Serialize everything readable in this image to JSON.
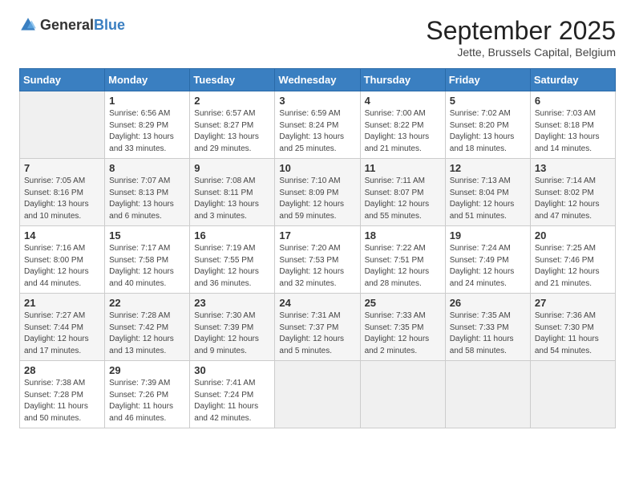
{
  "header": {
    "logo_general": "General",
    "logo_blue": "Blue",
    "month_year": "September 2025",
    "location": "Jette, Brussels Capital, Belgium"
  },
  "days_of_week": [
    "Sunday",
    "Monday",
    "Tuesday",
    "Wednesday",
    "Thursday",
    "Friday",
    "Saturday"
  ],
  "weeks": [
    [
      {
        "day": "",
        "sunrise": "",
        "sunset": "",
        "daylight": ""
      },
      {
        "day": "1",
        "sunrise": "Sunrise: 6:56 AM",
        "sunset": "Sunset: 8:29 PM",
        "daylight": "Daylight: 13 hours and 33 minutes."
      },
      {
        "day": "2",
        "sunrise": "Sunrise: 6:57 AM",
        "sunset": "Sunset: 8:27 PM",
        "daylight": "Daylight: 13 hours and 29 minutes."
      },
      {
        "day": "3",
        "sunrise": "Sunrise: 6:59 AM",
        "sunset": "Sunset: 8:24 PM",
        "daylight": "Daylight: 13 hours and 25 minutes."
      },
      {
        "day": "4",
        "sunrise": "Sunrise: 7:00 AM",
        "sunset": "Sunset: 8:22 PM",
        "daylight": "Daylight: 13 hours and 21 minutes."
      },
      {
        "day": "5",
        "sunrise": "Sunrise: 7:02 AM",
        "sunset": "Sunset: 8:20 PM",
        "daylight": "Daylight: 13 hours and 18 minutes."
      },
      {
        "day": "6",
        "sunrise": "Sunrise: 7:03 AM",
        "sunset": "Sunset: 8:18 PM",
        "daylight": "Daylight: 13 hours and 14 minutes."
      }
    ],
    [
      {
        "day": "7",
        "sunrise": "Sunrise: 7:05 AM",
        "sunset": "Sunset: 8:16 PM",
        "daylight": "Daylight: 13 hours and 10 minutes."
      },
      {
        "day": "8",
        "sunrise": "Sunrise: 7:07 AM",
        "sunset": "Sunset: 8:13 PM",
        "daylight": "Daylight: 13 hours and 6 minutes."
      },
      {
        "day": "9",
        "sunrise": "Sunrise: 7:08 AM",
        "sunset": "Sunset: 8:11 PM",
        "daylight": "Daylight: 13 hours and 3 minutes."
      },
      {
        "day": "10",
        "sunrise": "Sunrise: 7:10 AM",
        "sunset": "Sunset: 8:09 PM",
        "daylight": "Daylight: 12 hours and 59 minutes."
      },
      {
        "day": "11",
        "sunrise": "Sunrise: 7:11 AM",
        "sunset": "Sunset: 8:07 PM",
        "daylight": "Daylight: 12 hours and 55 minutes."
      },
      {
        "day": "12",
        "sunrise": "Sunrise: 7:13 AM",
        "sunset": "Sunset: 8:04 PM",
        "daylight": "Daylight: 12 hours and 51 minutes."
      },
      {
        "day": "13",
        "sunrise": "Sunrise: 7:14 AM",
        "sunset": "Sunset: 8:02 PM",
        "daylight": "Daylight: 12 hours and 47 minutes."
      }
    ],
    [
      {
        "day": "14",
        "sunrise": "Sunrise: 7:16 AM",
        "sunset": "Sunset: 8:00 PM",
        "daylight": "Daylight: 12 hours and 44 minutes."
      },
      {
        "day": "15",
        "sunrise": "Sunrise: 7:17 AM",
        "sunset": "Sunset: 7:58 PM",
        "daylight": "Daylight: 12 hours and 40 minutes."
      },
      {
        "day": "16",
        "sunrise": "Sunrise: 7:19 AM",
        "sunset": "Sunset: 7:55 PM",
        "daylight": "Daylight: 12 hours and 36 minutes."
      },
      {
        "day": "17",
        "sunrise": "Sunrise: 7:20 AM",
        "sunset": "Sunset: 7:53 PM",
        "daylight": "Daylight: 12 hours and 32 minutes."
      },
      {
        "day": "18",
        "sunrise": "Sunrise: 7:22 AM",
        "sunset": "Sunset: 7:51 PM",
        "daylight": "Daylight: 12 hours and 28 minutes."
      },
      {
        "day": "19",
        "sunrise": "Sunrise: 7:24 AM",
        "sunset": "Sunset: 7:49 PM",
        "daylight": "Daylight: 12 hours and 24 minutes."
      },
      {
        "day": "20",
        "sunrise": "Sunrise: 7:25 AM",
        "sunset": "Sunset: 7:46 PM",
        "daylight": "Daylight: 12 hours and 21 minutes."
      }
    ],
    [
      {
        "day": "21",
        "sunrise": "Sunrise: 7:27 AM",
        "sunset": "Sunset: 7:44 PM",
        "daylight": "Daylight: 12 hours and 17 minutes."
      },
      {
        "day": "22",
        "sunrise": "Sunrise: 7:28 AM",
        "sunset": "Sunset: 7:42 PM",
        "daylight": "Daylight: 12 hours and 13 minutes."
      },
      {
        "day": "23",
        "sunrise": "Sunrise: 7:30 AM",
        "sunset": "Sunset: 7:39 PM",
        "daylight": "Daylight: 12 hours and 9 minutes."
      },
      {
        "day": "24",
        "sunrise": "Sunrise: 7:31 AM",
        "sunset": "Sunset: 7:37 PM",
        "daylight": "Daylight: 12 hours and 5 minutes."
      },
      {
        "day": "25",
        "sunrise": "Sunrise: 7:33 AM",
        "sunset": "Sunset: 7:35 PM",
        "daylight": "Daylight: 12 hours and 2 minutes."
      },
      {
        "day": "26",
        "sunrise": "Sunrise: 7:35 AM",
        "sunset": "Sunset: 7:33 PM",
        "daylight": "Daylight: 11 hours and 58 minutes."
      },
      {
        "day": "27",
        "sunrise": "Sunrise: 7:36 AM",
        "sunset": "Sunset: 7:30 PM",
        "daylight": "Daylight: 11 hours and 54 minutes."
      }
    ],
    [
      {
        "day": "28",
        "sunrise": "Sunrise: 7:38 AM",
        "sunset": "Sunset: 7:28 PM",
        "daylight": "Daylight: 11 hours and 50 minutes."
      },
      {
        "day": "29",
        "sunrise": "Sunrise: 7:39 AM",
        "sunset": "Sunset: 7:26 PM",
        "daylight": "Daylight: 11 hours and 46 minutes."
      },
      {
        "day": "30",
        "sunrise": "Sunrise: 7:41 AM",
        "sunset": "Sunset: 7:24 PM",
        "daylight": "Daylight: 11 hours and 42 minutes."
      },
      {
        "day": "",
        "sunrise": "",
        "sunset": "",
        "daylight": ""
      },
      {
        "day": "",
        "sunrise": "",
        "sunset": "",
        "daylight": ""
      },
      {
        "day": "",
        "sunrise": "",
        "sunset": "",
        "daylight": ""
      },
      {
        "day": "",
        "sunrise": "",
        "sunset": "",
        "daylight": ""
      }
    ]
  ]
}
